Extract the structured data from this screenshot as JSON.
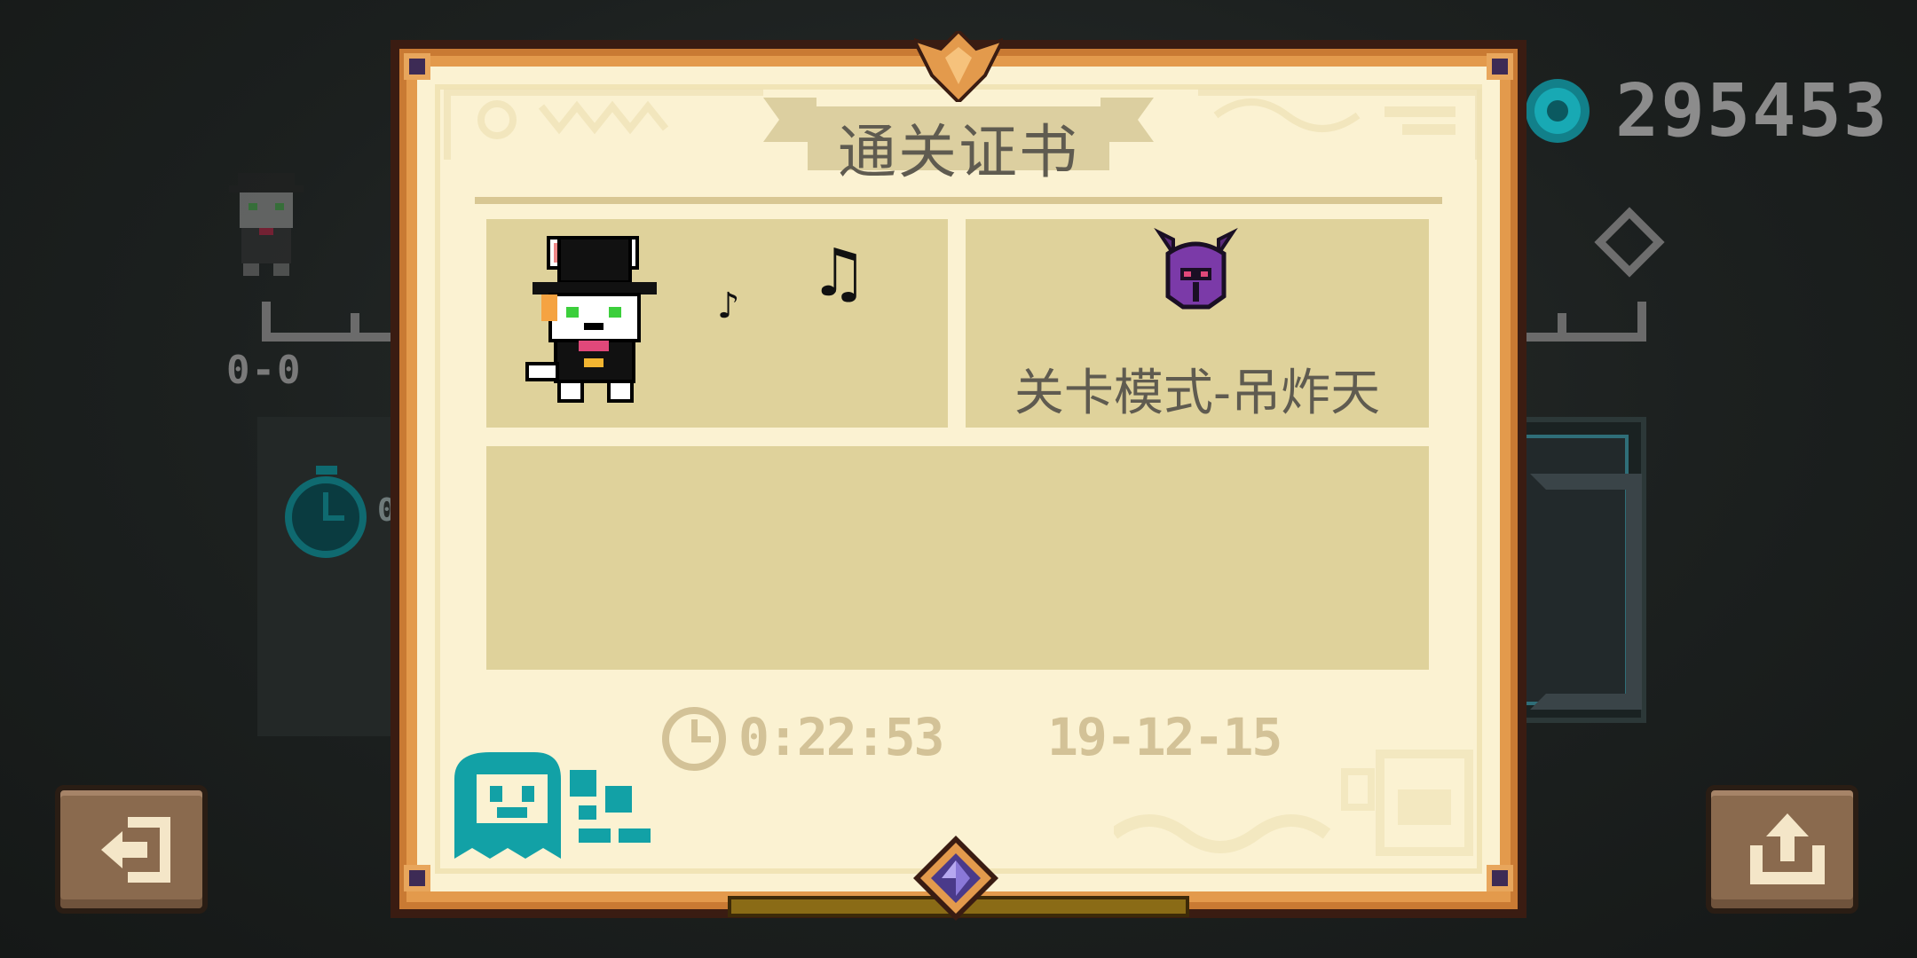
{
  "background": {
    "score": "0-0",
    "timer_value": "0",
    "coins": "295453"
  },
  "certificate": {
    "title": "通关证书",
    "mode_label": "关卡模式-吊炸天",
    "elapsed_time": "0:22:53",
    "date": "19-12-15",
    "notes": {
      "small": "♪",
      "big": "♫"
    }
  },
  "icons": {
    "exit": "exit-icon",
    "share": "share-icon",
    "coin": "gem-coin-icon",
    "clock": "clock-icon"
  },
  "colors": {
    "paper": "#fbf2d2",
    "panel": "#dfd29b",
    "frame": "#e39a4c",
    "button": "#8a6a4e",
    "teal": "#12a1a6",
    "faded_text": "#d3c297"
  }
}
